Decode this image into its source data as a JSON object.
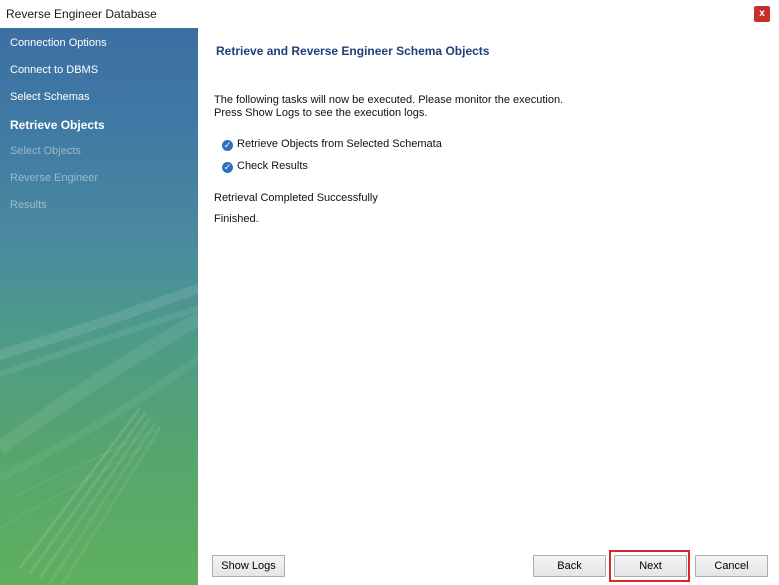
{
  "window": {
    "title": "Reverse Engineer Database",
    "close_label": "x"
  },
  "sidebar": {
    "steps": [
      {
        "label": "Connection Options",
        "state": "done"
      },
      {
        "label": "Connect to DBMS",
        "state": "done"
      },
      {
        "label": "Select Schemas",
        "state": "done"
      },
      {
        "label": "Retrieve Objects",
        "state": "current"
      },
      {
        "label": "Select Objects",
        "state": "pending"
      },
      {
        "label": "Reverse Engineer",
        "state": "pending"
      },
      {
        "label": "Results",
        "state": "pending"
      }
    ]
  },
  "main": {
    "title": "Retrieve and Reverse Engineer Schema Objects",
    "description_line1": "The following tasks will now be executed. Please monitor the execution.",
    "description_line2": "Press Show Logs to see the execution logs.",
    "tasks": [
      {
        "label": "Retrieve Objects from Selected Schemata",
        "status": "done"
      },
      {
        "label": "Check Results",
        "status": "done"
      }
    ],
    "status_message": "Retrieval Completed Successfully",
    "finished_message": "Finished."
  },
  "footer": {
    "show_logs_label": "Show Logs",
    "back_label": "Back",
    "next_label": "Next",
    "cancel_label": "Cancel"
  },
  "colors": {
    "title_blue": "#1f3f78",
    "check_blue": "#2f6fc4",
    "highlight_red": "#d42a2a",
    "close_red": "#c7312c"
  },
  "icons": {
    "check": "check-circle-icon",
    "close": "close-icon"
  }
}
